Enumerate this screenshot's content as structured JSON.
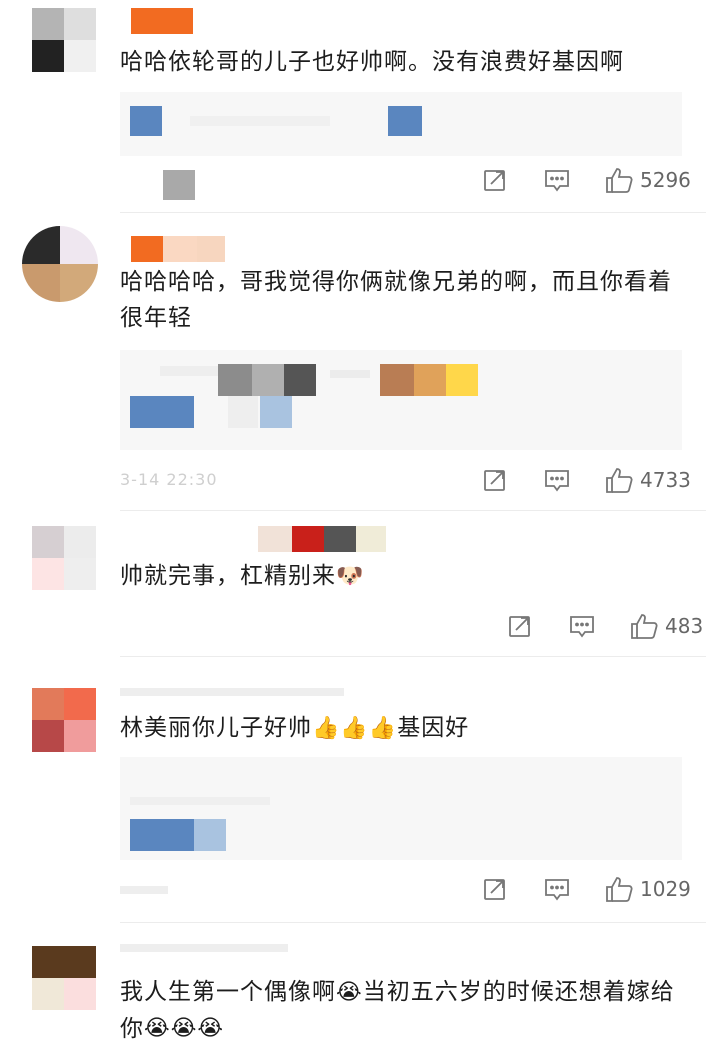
{
  "comments": [
    {
      "text": "哈哈依轮哥的儿子也好帅啊。没有浪费好基因啊",
      "likes": "5296",
      "avatar_colors": [
        "#b4b4b4",
        "#dedede",
        "#222222",
        "#f0f0f0"
      ],
      "name_colors": [
        "#f26b21",
        "#ffffff",
        "#ffffff"
      ]
    },
    {
      "text": "哈哈哈哈，哥我觉得你俩就像兄弟的啊，而且你看着很年轻",
      "likes": "4733",
      "time": "3-14 22:30",
      "avatar_colors": [
        "#2a2a2a",
        "#efe7f0",
        "#c99a6d",
        "#d2a97a"
      ],
      "name_colors": [
        "#f26b21",
        "#fad8c2",
        "#f7d6bf"
      ]
    },
    {
      "text": "帅就完事，杠精别来",
      "emoji_after": "🐶",
      "likes": "483",
      "avatar_colors": [
        "#d6cfd2",
        "#ececec",
        "#fde4e4",
        "#eeeeee"
      ],
      "name_colors": [
        "#f1e2d8",
        "#c9201a",
        "#555555",
        "#f0ecd8"
      ]
    },
    {
      "text": "林美丽你儿子好帅",
      "emoji_between": "👍👍👍",
      "text_after": "基因好",
      "likes": "1029",
      "avatar_colors": [
        "#e27a5a",
        "#f26a4c",
        "#b74848",
        "#f09c9c"
      ]
    },
    {
      "text_part1": "我人生第一个偶像啊",
      "emoji_1": "😭",
      "text_part2": "当初五六岁的时候还想着嫁给你",
      "emoji_2": "😭😭😭",
      "avatar_colors": [
        "#5a3a1e",
        "#f2f2f2",
        "#f0e8d8",
        "#fbdede"
      ]
    }
  ],
  "icons": {
    "share": "share-icon",
    "reply": "comment-icon",
    "like": "thumbs-up-icon"
  },
  "accent": "#f26b21"
}
